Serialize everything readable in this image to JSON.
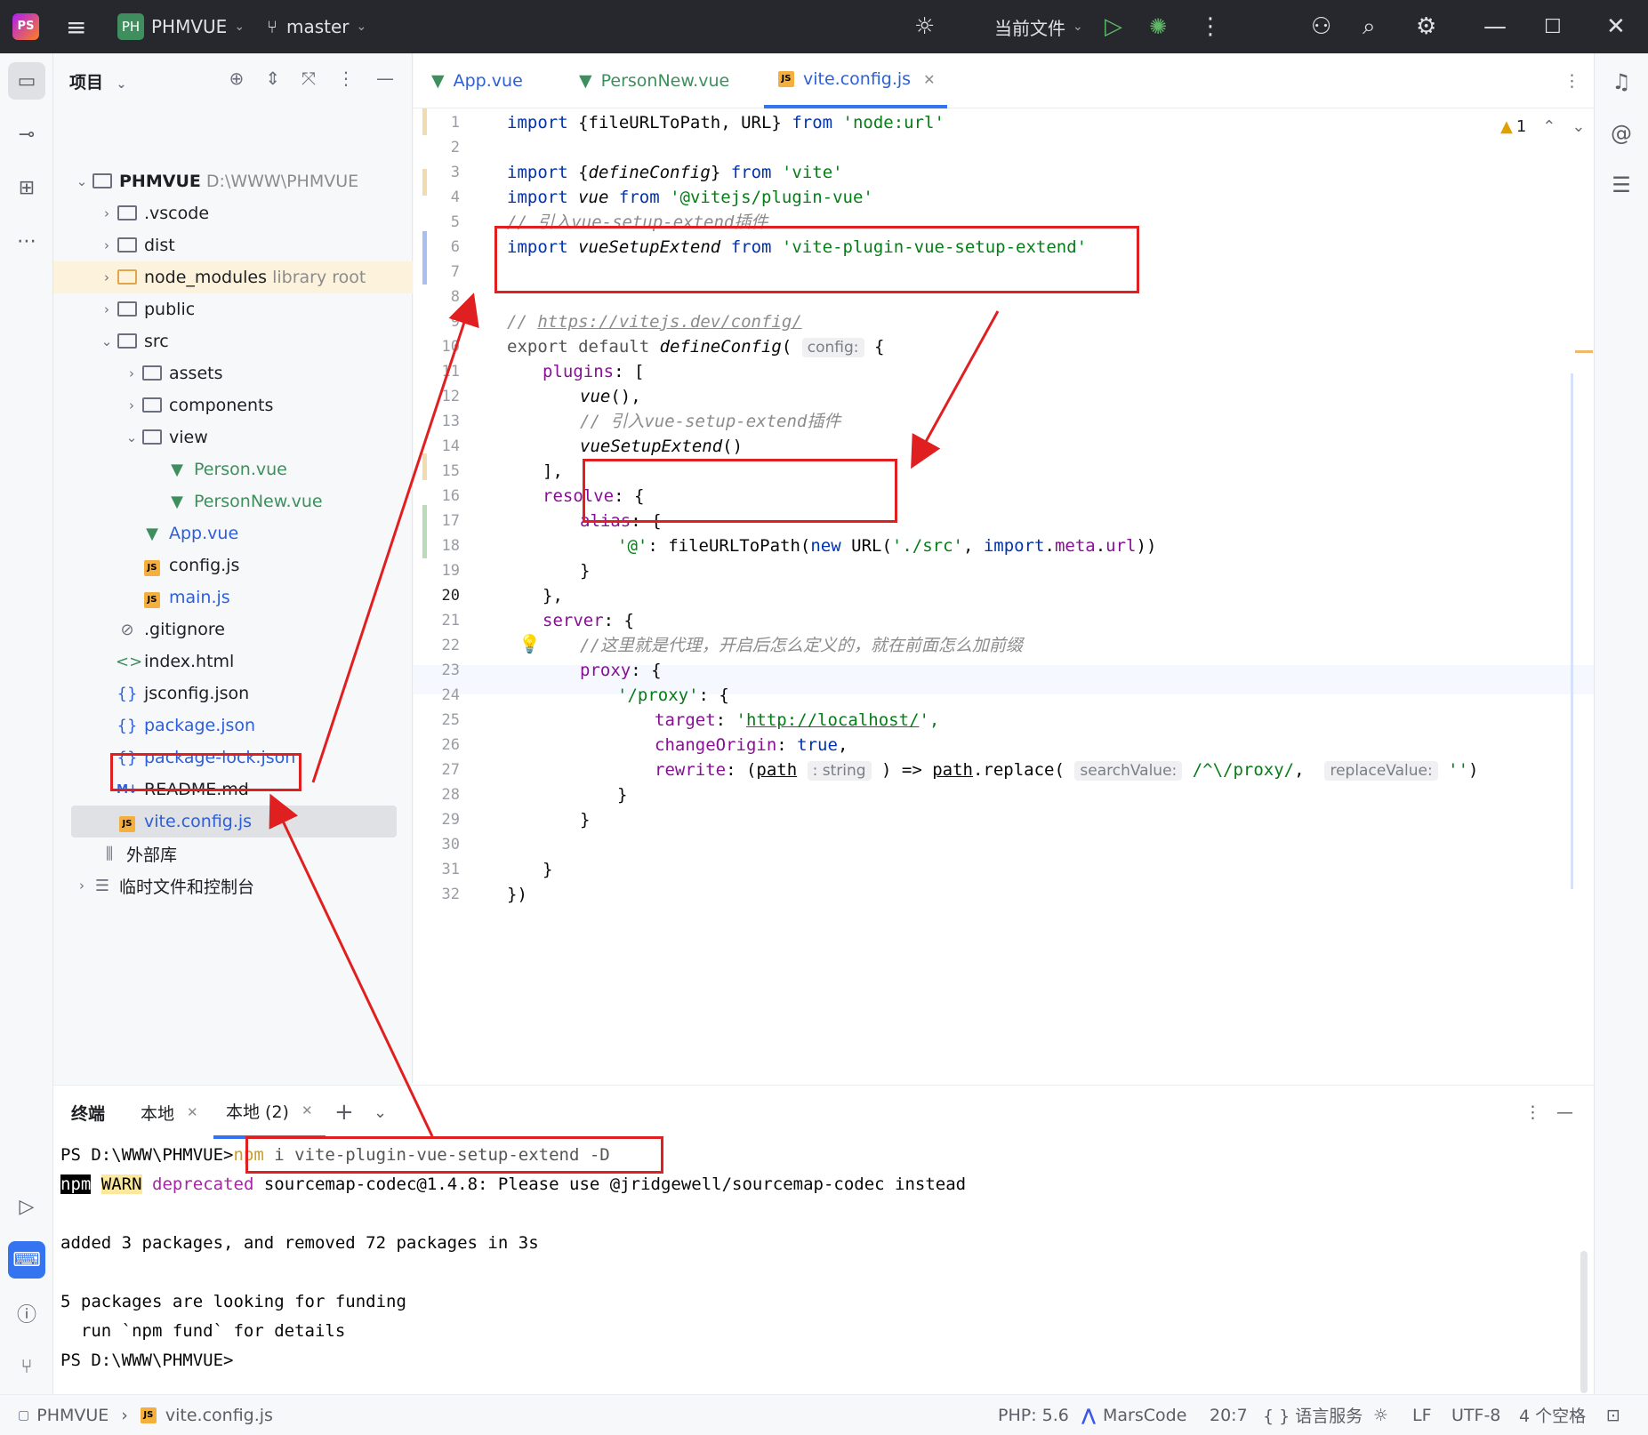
{
  "titlebar": {
    "project_badge": "PH",
    "project_name": "PHMVUE",
    "branch": "master",
    "run_config": "当前文件"
  },
  "project_panel": {
    "title": "项目",
    "root_name": "PHMVUE",
    "root_path": "D:\\WWW\\PHMVUE",
    "items": [
      {
        "label": ".vscode"
      },
      {
        "label": "dist"
      },
      {
        "label": "node_modules",
        "note": "library root"
      },
      {
        "label": "public"
      },
      {
        "label": "src"
      },
      {
        "label": "assets"
      },
      {
        "label": "components"
      },
      {
        "label": "view"
      },
      {
        "label": "Person.vue"
      },
      {
        "label": "PersonNew.vue"
      },
      {
        "label": "App.vue"
      },
      {
        "label": "config.js"
      },
      {
        "label": "main.js"
      },
      {
        "label": ".gitignore"
      },
      {
        "label": "index.html"
      },
      {
        "label": "jsconfig.json"
      },
      {
        "label": "package.json"
      },
      {
        "label": "package-lock.json"
      },
      {
        "label": "README.md"
      },
      {
        "label": "vite.config.js"
      },
      {
        "label": "外部库"
      },
      {
        "label": "临时文件和控制台"
      }
    ]
  },
  "editor": {
    "tabs": [
      {
        "label": "App.vue"
      },
      {
        "label": "PersonNew.vue"
      },
      {
        "label": "vite.config.js"
      }
    ],
    "warnings": "1",
    "hints": {
      "config": "config:",
      "path_type": ": string",
      "search": "searchValue:",
      "replace": "replaceValue:"
    }
  },
  "code_lines": [
    "",
    "",
    "",
    "",
    "",
    "",
    "",
    "",
    "",
    "",
    "",
    "",
    "",
    "",
    "",
    "",
    "",
    "",
    "",
    "",
    "",
    "",
    "",
    "",
    "",
    "",
    "",
    "",
    "",
    "",
    "",
    ""
  ],
  "line_numbers": [
    "1",
    "2",
    "3",
    "4",
    "5",
    "6",
    "7",
    "8",
    "9",
    "10",
    "11",
    "12",
    "13",
    "14",
    "15",
    "16",
    "17",
    "18",
    "19",
    "20",
    "21",
    "22",
    "23",
    "24",
    "25",
    "26",
    "27",
    "28",
    "29",
    "30",
    "31",
    "32"
  ],
  "code": {
    "l1": [
      "import",
      "{fileURLToPath, URL}",
      "from",
      "'node:url'"
    ],
    "l3": [
      "import",
      "{",
      "defineConfig",
      "}",
      "from",
      "'vite'"
    ],
    "l4": [
      "import",
      "vue",
      "from",
      "'@vitejs/plugin-vue'"
    ],
    "l5": "// 引入vue-setup-extend插件",
    "l6": [
      "import",
      "vueSetupExtend",
      "from",
      "'vite-plugin-vue-setup-extend'"
    ],
    "l9": [
      "// ",
      "https://vitejs.dev/config/"
    ],
    "l10": [
      "export default ",
      "defineConfig",
      "(",
      "{"
    ],
    "l11": [
      "plugins",
      ": ["
    ],
    "l12": [
      "vue",
      "(),"
    ],
    "l13": "// 引入vue-setup-extend插件",
    "l14": [
      "vueSetupExtend",
      "()"
    ],
    "l15": "],",
    "l16": [
      "resolve",
      ": {"
    ],
    "l17": [
      "alias",
      ": {"
    ],
    "l18": [
      "'@'",
      ": fileURLToPath(",
      "new",
      " URL(",
      "'./src'",
      ", ",
      "import",
      ".",
      "meta",
      ".",
      "url",
      "))"
    ],
    "l19": "}",
    "l20": "},",
    "l21": [
      "server",
      ": {"
    ],
    "l22": "//这里就是代理，开启后怎么定义的，就在前面怎么加前缀",
    "l23": [
      "proxy",
      ": {"
    ],
    "l24": [
      "'/proxy'",
      ": {"
    ],
    "l25": [
      "target",
      ": ",
      "'",
      "http://localhost/",
      "',"
    ],
    "l26": [
      "changeOrigin",
      ": ",
      "true",
      ","
    ],
    "l27": [
      "rewrite",
      ": (",
      "path",
      ") => ",
      "path",
      ".replace(",
      "/^\\/proxy/",
      ", ",
      "''",
      ")"
    ],
    "l28": "}",
    "l29": "}",
    "l31": "}",
    "l32": "})"
  },
  "terminal": {
    "title": "终端",
    "tab1": "本地",
    "tab2": "本地 (2)",
    "prompt": "PS D:\\WWW\\PHMVUE>",
    "cmd_npm": "npm",
    "cmd_rest": " i vite-plugin-vue-setup-extend -D",
    "warn_npm": "npm",
    "warn_warn": "WARN",
    "warn_dep": "deprecated",
    "warn_rest": " sourcemap-codec@1.4.8: Please use @jridgewell/sourcemap-codec instead",
    "added": "added 3 packages, and removed 72 packages in 3s",
    "funding": "5 packages are looking for funding",
    "fund_details": "  run `npm fund` for details",
    "prompt_end": "PS D:\\WWW\\PHMVUE>"
  },
  "statusbar": {
    "crumb_project": "PHMVUE",
    "crumb_file": "vite.config.js",
    "php": "PHP: 5.6",
    "marscode": "MarsCode",
    "position": "20:7",
    "lang": "{ } 语言服务",
    "line_ending": "LF",
    "encoding": "UTF-8",
    "indent": "4 个空格"
  },
  "colors": {
    "accent": "#3574f0",
    "annotation_red": "#e02020",
    "vue_green": "#3e8e5e",
    "keyword": "#0033b3",
    "string": "#067d17"
  }
}
